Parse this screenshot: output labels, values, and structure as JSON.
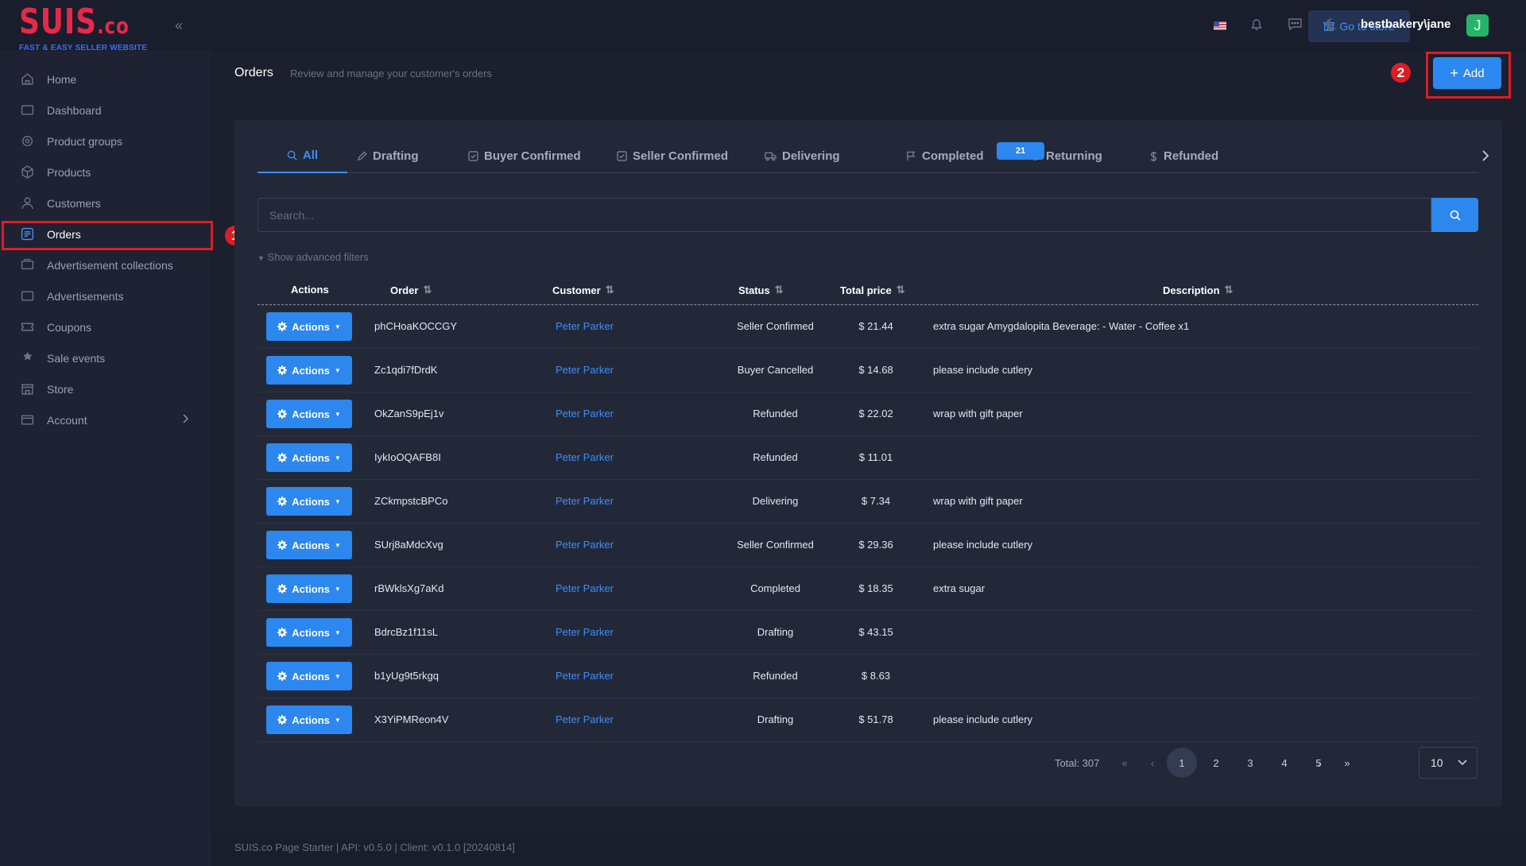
{
  "brand": {
    "logo_main": "SUIS",
    "logo_suffix": ".co",
    "tagline": "FAST & EASY SELLER WEBSITE",
    "logo_color": "#e6294a"
  },
  "sidebar": {
    "items": [
      {
        "label": "Home",
        "icon": "home-icon"
      },
      {
        "label": "Dashboard",
        "icon": "dashboard-icon"
      },
      {
        "label": "Product groups",
        "icon": "product-groups-icon"
      },
      {
        "label": "Products",
        "icon": "products-icon"
      },
      {
        "label": "Customers",
        "icon": "customers-icon"
      },
      {
        "label": "Orders",
        "icon": "orders-icon",
        "active": true
      },
      {
        "label": "Advertisement collections",
        "icon": "ad-collections-icon"
      },
      {
        "label": "Advertisements",
        "icon": "advertisements-icon"
      },
      {
        "label": "Coupons",
        "icon": "coupons-icon"
      },
      {
        "label": "Sale events",
        "icon": "sale-events-icon"
      },
      {
        "label": "Store",
        "icon": "store-icon"
      },
      {
        "label": "Account",
        "icon": "account-icon"
      }
    ]
  },
  "annotations": {
    "orders_marker": "1",
    "add_marker": "2",
    "highlight_color": "#e01b24"
  },
  "topbar": {
    "go_to_store": "Go to store",
    "user": "bestbakery\\jane",
    "avatar_initial": "J"
  },
  "header": {
    "title": "Orders",
    "subtitle": "Review and manage your customer's orders",
    "add_label": "Add"
  },
  "tabs": [
    {
      "label": "All",
      "icon": "search-icon",
      "active": true
    },
    {
      "label": "Drafting",
      "icon": "pencil-icon"
    },
    {
      "label": "Buyer Confirmed",
      "icon": "checkbox-icon"
    },
    {
      "label": "Seller Confirmed",
      "icon": "checkbox-icon"
    },
    {
      "label": "Delivering",
      "icon": "truck-icon",
      "count": "21"
    },
    {
      "label": "Completed",
      "icon": "flag-icon"
    },
    {
      "label": "Returning",
      "icon": "return-icon"
    },
    {
      "label": "Refunded",
      "icon": "dollar-icon"
    }
  ],
  "search": {
    "placeholder": "Search...",
    "advanced_filters": "Show advanced filters"
  },
  "table": {
    "columns": [
      "Actions",
      "Order",
      "Customer",
      "Status",
      "Total price",
      "Description"
    ],
    "action_label": "Actions",
    "rows": [
      {
        "order": "phCHoaKOCCGY",
        "customer": "Peter Parker",
        "status": "Seller Confirmed",
        "total": "$ 21.44",
        "description": "extra sugar Amygdalopita Beverage: - Water - Coffee x1"
      },
      {
        "order": "Zc1qdi7fDrdK",
        "customer": "Peter Parker",
        "status": "Buyer Cancelled",
        "total": "$ 14.68",
        "description": "please include cutlery"
      },
      {
        "order": "OkZanS9pEj1v",
        "customer": "Peter Parker",
        "status": "Refunded",
        "total": "$ 22.02",
        "description": "wrap with gift paper"
      },
      {
        "order": "IykIoOQAFB8I",
        "customer": "Peter Parker",
        "status": "Refunded",
        "total": "$ 11.01",
        "description": ""
      },
      {
        "order": "ZCkmpstcBPCo",
        "customer": "Peter Parker",
        "status": "Delivering",
        "total": "$ 7.34",
        "description": "wrap with gift paper"
      },
      {
        "order": "SUrj8aMdcXvg",
        "customer": "Peter Parker",
        "status": "Seller Confirmed",
        "total": "$ 29.36",
        "description": "please include cutlery"
      },
      {
        "order": "rBWklsXg7aKd",
        "customer": "Peter Parker",
        "status": "Completed",
        "total": "$ 18.35",
        "description": "extra sugar"
      },
      {
        "order": "BdrcBz1f11sL",
        "customer": "Peter Parker",
        "status": "Drafting",
        "total": "$ 43.15",
        "description": ""
      },
      {
        "order": "b1yUg9t5rkgq",
        "customer": "Peter Parker",
        "status": "Refunded",
        "total": "$ 8.63",
        "description": ""
      },
      {
        "order": "X3YiPMReon4V",
        "customer": "Peter Parker",
        "status": "Drafting",
        "total": "$ 51.78",
        "description": "please include cutlery"
      }
    ]
  },
  "pagination": {
    "total": "Total: 307",
    "pages": [
      "1",
      "2",
      "3",
      "4",
      "5"
    ],
    "current": "1",
    "page_size": "10"
  },
  "footer": {
    "text": "SUIS.co Page Starter | API: v0.5.0 | Client: v0.1.0 [20240814]"
  }
}
